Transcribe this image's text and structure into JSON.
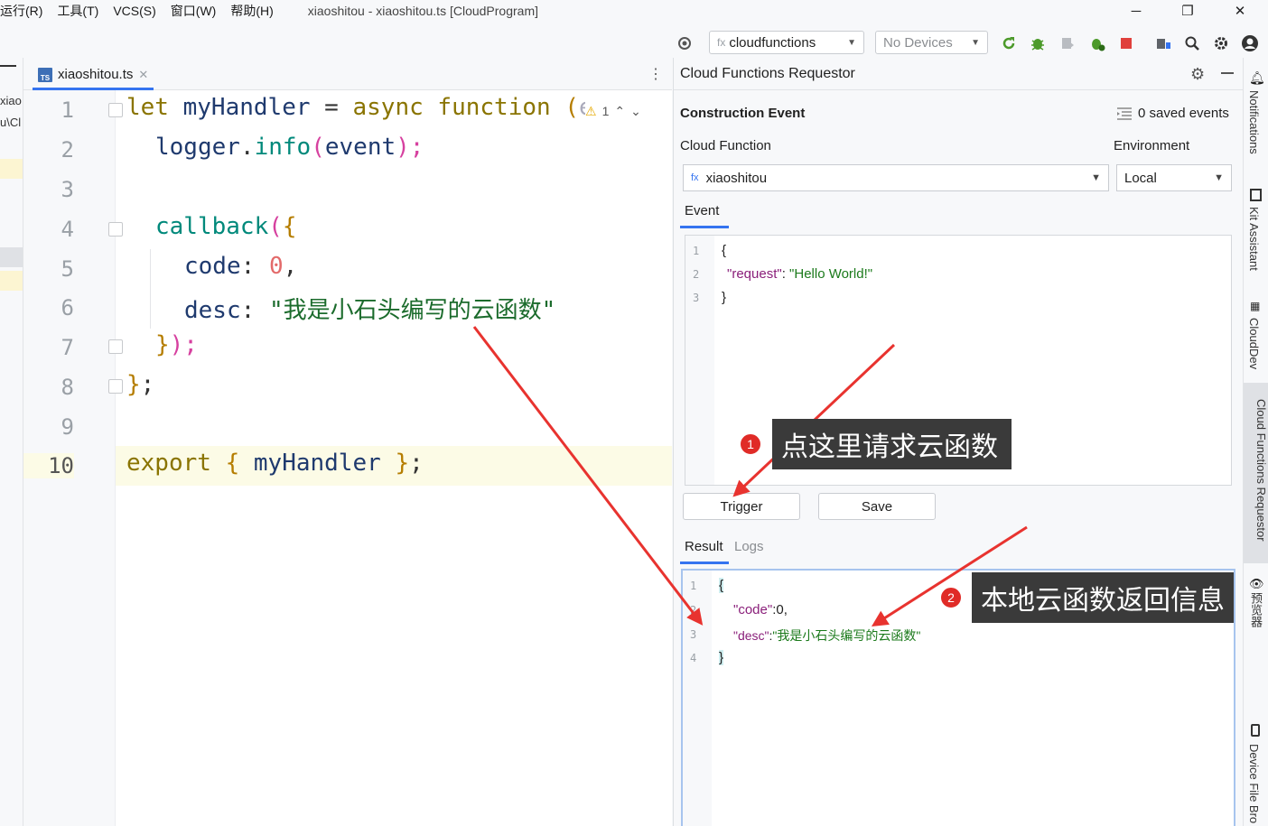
{
  "menu": {
    "items": [
      "运行(R)",
      "工具(T)",
      "VCS(S)",
      "窗口(W)",
      "帮助(H)"
    ],
    "window_title": "xiaoshitou - xiaoshitou.ts [CloudProgram]"
  },
  "toolbar": {
    "config_label": "cloudfunctions",
    "config_prefix": "fx",
    "device_label": "No Devices"
  },
  "left_strip": {
    "line1": "xiao",
    "line2": "u\\Cl"
  },
  "editor": {
    "tab_label": "xiaoshitou.ts",
    "tab_badge": "TS",
    "warning_count": "1",
    "line_numbers": [
      "1",
      "2",
      "3",
      "4",
      "5",
      "6",
      "7",
      "8",
      "9",
      "10"
    ],
    "code": {
      "l1_let": "let",
      "l1_name": "myHandler",
      "l1_eq": "=",
      "l1_async": "async",
      "l1_function": "function",
      "l1_paren": "(",
      "l1_rest": "event",
      "l2_logger": "logger",
      "l2_dot": ".",
      "l2_info": "info",
      "l2_open": "(",
      "l2_arg": "event",
      "l2_close": ");",
      "l4_callback": "callback",
      "l4_paren": "(",
      "l4_brace": "{",
      "l5_key": "code",
      "l5_colon": ":",
      "l5_val": "0",
      "l5_comma": ",",
      "l6_key": "desc",
      "l6_colon": ":",
      "l6_val": "\"我是小石头编写的云函数\"",
      "l7_brace": "}",
      "l7_close": ");",
      "l8_brace": "}",
      "l8_semi": ";",
      "l10_export": "export",
      "l10_open": "{",
      "l10_name": "myHandler",
      "l10_close": "}",
      "l10_semi": ";"
    }
  },
  "panel": {
    "title": "Cloud Functions Requestor",
    "section_title": "Construction Event",
    "saved_events": "0 saved events",
    "cloud_function_label": "Cloud Function",
    "environment_label": "Environment",
    "function_prefix": "fx",
    "function_value": "xiaoshitou",
    "environment_value": "Local",
    "event_tab": "Event",
    "event_lines": [
      "1",
      "2",
      "3"
    ],
    "event_open": "{",
    "event_key": "\"request\"",
    "event_colon": ": ",
    "event_value": "\"Hello World!\"",
    "event_close": "}",
    "trigger_label": "Trigger",
    "save_label": "Save",
    "result_tab": "Result",
    "logs_tab": "Logs",
    "result_lines": [
      "1",
      "2",
      "3",
      "4"
    ],
    "result_open": "{",
    "result_code_key": "\"code\"",
    "result_code_rest": ":0,",
    "result_desc_key": "\"desc\"",
    "result_desc_colon": ":",
    "result_desc_value": "\"我是小石头编写的云函数\"",
    "result_close": "}"
  },
  "right_strip": {
    "tabs": [
      "Notifications",
      "Kit Assistant",
      "CloudDev",
      "Cloud Functions Requestor",
      "预览器",
      "Device File Bro"
    ]
  },
  "annotations": {
    "badge1": "1",
    "callout1": "点这里请求云函数",
    "badge2": "2",
    "callout2": "本地云函数返回信息",
    "arrow_color": "#e8332f"
  }
}
